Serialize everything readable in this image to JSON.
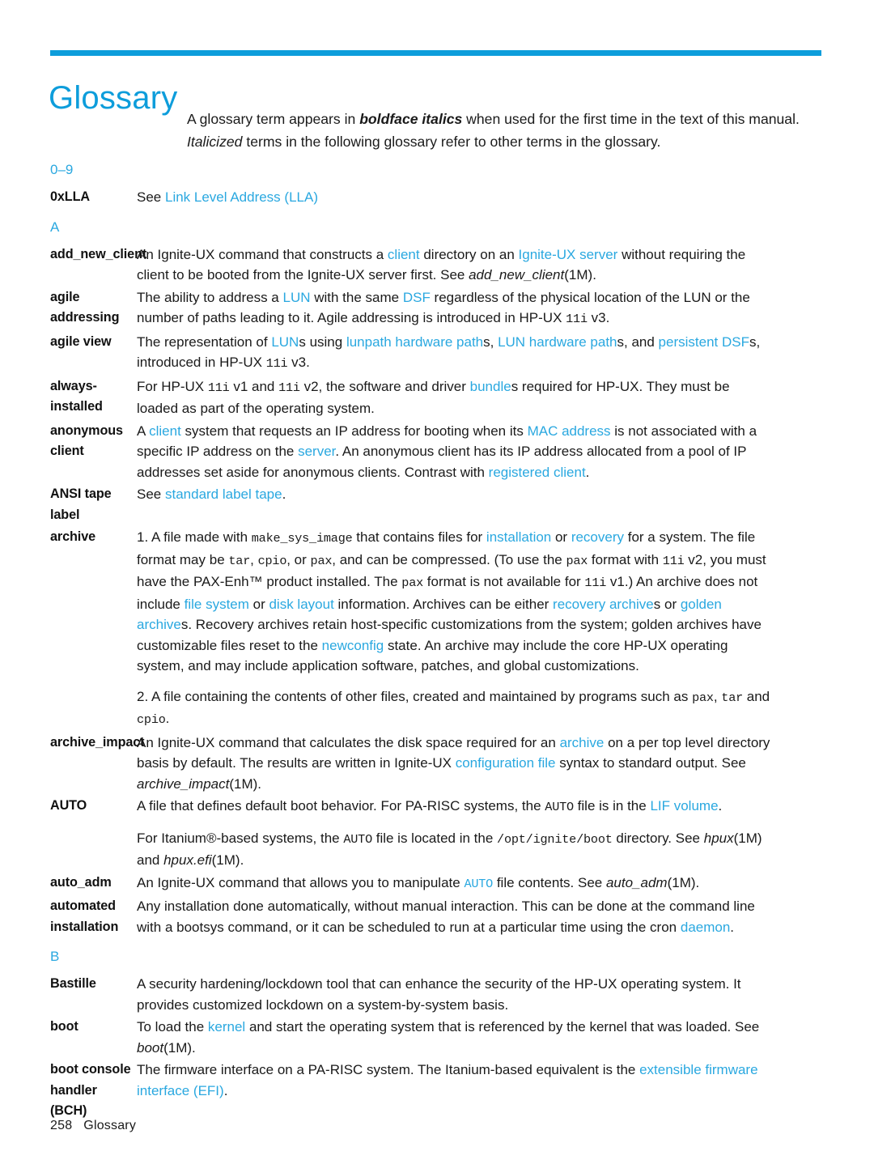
{
  "header": {
    "title": "Glossary",
    "accent_color": "#0d9ddb",
    "link_color": "#2aa8e0"
  },
  "intro": {
    "part1": "A glossary term appears in ",
    "bold_italic": "boldface italics",
    "part2": " when used for the first time in the text of this manual. ",
    "italic": "Italicized",
    "part3": " terms in the following glossary refer to other terms in the glossary."
  },
  "sections": [
    {
      "letter": "0–9"
    },
    {
      "letter": "A"
    },
    {
      "letter": "B"
    }
  ],
  "entries": {
    "oxlla": {
      "term": "0xLLA",
      "see": "See ",
      "link": "Link Level Address (LLA)"
    },
    "add_new_client": {
      "term": "add_new_client",
      "t1": "An Ignite-UX command that constructs a ",
      "l1": "client",
      "t2": " directory on an ",
      "l2": "Ignite-UX server",
      "t3": " without requiring the client to be booted from the Ignite-UX server first. See ",
      "i1": "add_new_client",
      "t4": "(1M)."
    },
    "agile_addressing": {
      "term": "agile addressing",
      "t1": "The ability to address a ",
      "l1": "LUN",
      "t2": " with the same ",
      "l2": "DSF",
      "t3": " regardless of the physical location of the LUN or the number of paths leading to it. Agile addressing is introduced in HP-UX ",
      "m1": "11i",
      "t4": " v3."
    },
    "agile_view": {
      "term": "agile view",
      "t1": "The representation of ",
      "l1": "LUN",
      "t2": "s using ",
      "l2": "lunpath hardware path",
      "t3": "s, ",
      "l3": "LUN hardware path",
      "t4": "s, and ",
      "l4": "persistent DSF",
      "t5": "s, introduced in HP-UX ",
      "m1": "11i",
      "t6": " v3."
    },
    "always_installed": {
      "term": "always-installed",
      "t1": "For HP-UX ",
      "m1": "11i",
      "t2": " v1 and ",
      "m2": "11i",
      "t3": " v2, the software and driver ",
      "l1": "bundle",
      "t4": "s required for HP-UX. They must be loaded as part of the operating system."
    },
    "anonymous_client": {
      "term": "anonymous client",
      "t1": "A ",
      "l1": "client",
      "t2": " system that requests an IP address for booting when its ",
      "l2": "MAC address",
      "t3": " is not associated with a specific IP address on the ",
      "l3": "server",
      "t4": ". An anonymous client has its IP address allocated from a pool of IP addresses set aside for anonymous clients. Contrast with ",
      "l4": "registered client",
      "t5": "."
    },
    "ansi_tape_label": {
      "term": "ANSI tape label",
      "t1": "See ",
      "l1": "standard label tape",
      "t2": "."
    },
    "archive": {
      "term": "archive",
      "p1": {
        "t1": "1. A file made with ",
        "m1": "make_sys_image",
        "t2": " that contains files for ",
        "l1": "installation",
        "t3": " or ",
        "l2": "recovery",
        "t4": " for a system. The file format may be ",
        "m2": "tar",
        "t5": ", ",
        "m3": "cpio",
        "t6": ", or ",
        "m4": "pax",
        "t7": ", and can be compressed. (To use the ",
        "m5": "pax",
        "t8": " format with ",
        "m6": "11i",
        "t9": " v2, you must have the PAX-Enh™ product installed. The ",
        "m7": "pax",
        "t10": " format is not available for ",
        "m8": "11i",
        "t11": " v1.) An archive does not include ",
        "l3": "file system",
        "t12": " or ",
        "l4": "disk layout",
        "t13": " information. Archives can be either ",
        "l5": "recovery archive",
        "t14": "s or ",
        "l6": "golden archive",
        "t15": "s. Recovery archives retain host-specific customizations from the system; golden archives have customizable files reset to the ",
        "l7": "newconfig",
        "t16": " state. An archive may include the core HP-UX operating system, and may include application software, patches, and global customizations."
      },
      "p2": {
        "t1": "2. A file containing the contents of other files, created and maintained by programs such as ",
        "m1": "pax",
        "t2": ", ",
        "m2": "tar",
        "t3": " and ",
        "m3": "cpio",
        "t4": "."
      }
    },
    "archive_impact": {
      "term": "archive_impact",
      "t1": "An Ignite-UX command that calculates the disk space required for an ",
      "l1": "archive",
      "t2": " on a per top level directory basis by default. The results are written in Ignite-UX ",
      "l2": "configuration file",
      "t3": " syntax to standard output. See ",
      "i1": "archive_impact",
      "t4": "(1M)."
    },
    "auto": {
      "term": "AUTO",
      "p1": {
        "t1": "A file that defines default boot behavior. For PA-RISC systems, the ",
        "m1": "AUTO",
        "t2": " file is in the ",
        "l1": "LIF volume",
        "t3": "."
      },
      "p2": {
        "t1": "For Itanium®-based systems, the ",
        "m1": "AUTO",
        "t2": " file is located in the ",
        "m2": "/opt/ignite/boot",
        "t3": " directory. See ",
        "i1": "hpux",
        "t4": "(1M) and ",
        "i2": "hpux.efi",
        "t5": "(1M)."
      }
    },
    "auto_adm": {
      "term": "auto_adm",
      "t1": "An Ignite-UX command that allows you to manipulate ",
      "ml1": "AUTO",
      "t2": " file contents. See ",
      "i1": "auto_adm",
      "t3": "(1M)."
    },
    "automated_installation": {
      "term_line1": "automated",
      "term_line2": "installation",
      "t1": "Any installation done automatically, without manual interaction. This can be done at the command line with a bootsys command, or it can be scheduled to run at a particular time using the cron ",
      "l1": "daemon",
      "t2": "."
    },
    "bastille": {
      "term": "Bastille",
      "t1": "A security hardening/lockdown tool that can enhance the security of the HP-UX operating system. It provides customized lockdown on a system-by-system basis."
    },
    "boot": {
      "term": "boot",
      "t1": "To load the ",
      "l1": "kernel",
      "t2": " and start the operating system that is referenced by the kernel that was loaded. See ",
      "i1": "boot",
      "t3": "(1M)."
    },
    "boot_console_handler": {
      "term_line1": "boot console",
      "term_line2": "handler (BCH)",
      "t1": "The firmware interface on a PA-RISC system. The Itanium-based equivalent is the ",
      "l1": "extensible firmware interface (EFI)",
      "t2": "."
    }
  },
  "footer": {
    "page_number": "258",
    "label": "Glossary"
  }
}
